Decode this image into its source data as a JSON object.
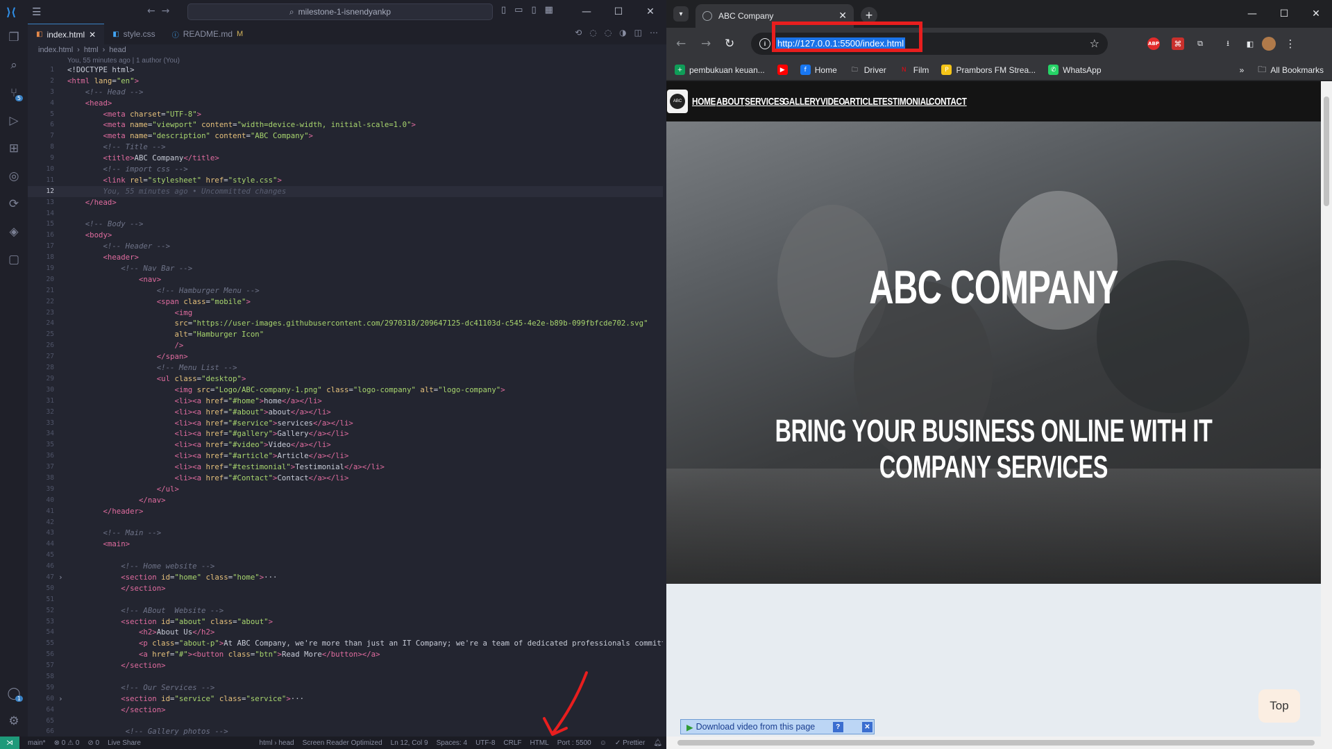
{
  "vscode": {
    "search": "milestone-1-isnendyankp",
    "tabs": [
      {
        "label": "index.html",
        "close": "✕"
      },
      {
        "label": "style.css"
      },
      {
        "label": "README.md",
        "mod": "M"
      }
    ],
    "breadcrumb": [
      "index.html",
      "html",
      "head"
    ],
    "blame": "You, 55 minutes ago | 1 author (You)",
    "status": {
      "branch": "main*",
      "problems": "⊗ 0 ⚠ 0",
      "ports": "⊘ 0",
      "liveshare": "Live Share",
      "scope": "html › head",
      "screenreader": "Screen Reader Optimized",
      "position": "Ln 12, Col 9",
      "spaces": "Spaces: 4",
      "encoding": "UTF-8",
      "eol": "CRLF",
      "language": "HTML",
      "port": "Port : 5500",
      "prettier": "✓ Prettier"
    },
    "code_lines": [
      {
        "n": "1",
        "h": "<span class=\"p\">&lt;!DOCTYPE html&gt;</span>"
      },
      {
        "n": "2",
        "h": "<span class=\"t\">&lt;html</span> <span class=\"a\">lang</span>=<span class=\"s\">\"en\"</span><span class=\"t\">&gt;</span>"
      },
      {
        "n": "3",
        "h": "    <span class=\"c\">&lt;!-- Head --&gt;</span>"
      },
      {
        "n": "4",
        "h": "    <span class=\"t\">&lt;head&gt;</span>"
      },
      {
        "n": "5",
        "h": "        <span class=\"t\">&lt;meta</span> <span class=\"a\">charset</span>=<span class=\"s\">\"UTF-8\"</span><span class=\"t\">&gt;</span>"
      },
      {
        "n": "6",
        "h": "        <span class=\"t\">&lt;meta</span> <span class=\"a\">name</span>=<span class=\"s\">\"viewport\"</span> <span class=\"a\">content</span>=<span class=\"s\">\"width=device-width, initial-scale=1.0\"</span><span class=\"t\">&gt;</span>"
      },
      {
        "n": "7",
        "h": "        <span class=\"t\">&lt;meta</span> <span class=\"a\">name</span>=<span class=\"s\">\"description\"</span> <span class=\"a\">content</span>=<span class=\"s\">\"ABC Company\"</span><span class=\"t\">&gt;</span>"
      },
      {
        "n": "8",
        "h": "        <span class=\"c\">&lt;!-- Title --&gt;</span>"
      },
      {
        "n": "9",
        "h": "        <span class=\"t\">&lt;title&gt;</span>ABC Company<span class=\"t\">&lt;/title&gt;</span>"
      },
      {
        "n": "10",
        "h": "        <span class=\"c\">&lt;!-- import css --&gt;</span>"
      },
      {
        "n": "11",
        "h": "        <span class=\"t\">&lt;link</span> <span class=\"a\">rel</span>=<span class=\"s\">\"stylesheet\"</span> <span class=\"a\">href</span>=<span class=\"s\">\"style.css\"</span><span class=\"t\">&gt;</span>"
      },
      {
        "n": "12",
        "h": "        <span class=\"g\">You, 55 minutes ago • Uncommitted changes</span>",
        "cur": true
      },
      {
        "n": "13",
        "h": "    <span class=\"t\">&lt;/head&gt;</span>"
      },
      {
        "n": "14",
        "h": ""
      },
      {
        "n": "15",
        "h": "    <span class=\"c\">&lt;!-- Body --&gt;</span>"
      },
      {
        "n": "16",
        "h": "    <span class=\"t\">&lt;body&gt;</span>"
      },
      {
        "n": "17",
        "h": "        <span class=\"c\">&lt;!-- Header --&gt;</span>"
      },
      {
        "n": "18",
        "h": "        <span class=\"t\">&lt;header&gt;</span>"
      },
      {
        "n": "19",
        "h": "            <span class=\"c\">&lt;!-- Nav Bar --&gt;</span>"
      },
      {
        "n": "20",
        "h": "                <span class=\"t\">&lt;nav&gt;</span>"
      },
      {
        "n": "21",
        "h": "                    <span class=\"c\">&lt;!-- Hamburger Menu --&gt;</span>"
      },
      {
        "n": "22",
        "h": "                    <span class=\"t\">&lt;span</span> <span class=\"a\">class</span>=<span class=\"s\">\"mobile\"</span><span class=\"t\">&gt;</span>"
      },
      {
        "n": "23",
        "h": "                        <span class=\"t\">&lt;img</span>"
      },
      {
        "n": "24",
        "h": "                        <span class=\"a\">src</span>=<span class=\"s\">\"https://user-images.githubusercontent.com/2970318/209647125-dc41103d-c545-4e2e-b89b-099fbfcde702.svg\"</span>"
      },
      {
        "n": "25",
        "h": "                        <span class=\"a\">alt</span>=<span class=\"s\">\"Hamburger Icon\"</span>"
      },
      {
        "n": "26",
        "h": "                        <span class=\"t\">/&gt;</span>"
      },
      {
        "n": "27",
        "h": "                    <span class=\"t\">&lt;/span&gt;</span>"
      },
      {
        "n": "28",
        "h": "                    <span class=\"c\">&lt;!-- Menu List --&gt;</span>"
      },
      {
        "n": "29",
        "h": "                    <span class=\"t\">&lt;ul</span> <span class=\"a\">class</span>=<span class=\"s\">\"desktop\"</span><span class=\"t\">&gt;</span>"
      },
      {
        "n": "30",
        "h": "                        <span class=\"t\">&lt;img</span> <span class=\"a\">src</span>=<span class=\"s\">\"Logo/ABC-company-1.png\"</span> <span class=\"a\">class</span>=<span class=\"s\">\"logo-company\"</span> <span class=\"a\">alt</span>=<span class=\"s\">\"logo-company\"</span><span class=\"t\">&gt;</span>"
      },
      {
        "n": "31",
        "h": "                        <span class=\"t\">&lt;li&gt;&lt;a</span> <span class=\"a\">href</span>=<span class=\"s\">\"#home\"</span><span class=\"t\">&gt;</span>home<span class=\"t\">&lt;/a&gt;&lt;/li&gt;</span>"
      },
      {
        "n": "32",
        "h": "                        <span class=\"t\">&lt;li&gt;&lt;a</span> <span class=\"a\">href</span>=<span class=\"s\">\"#about\"</span><span class=\"t\">&gt;</span>about<span class=\"t\">&lt;/a&gt;&lt;/li&gt;</span>"
      },
      {
        "n": "33",
        "h": "                        <span class=\"t\">&lt;li&gt;&lt;a</span> <span class=\"a\">href</span>=<span class=\"s\">\"#service\"</span><span class=\"t\">&gt;</span>services<span class=\"t\">&lt;/a&gt;&lt;/li&gt;</span>"
      },
      {
        "n": "34",
        "h": "                        <span class=\"t\">&lt;li&gt;&lt;a</span> <span class=\"a\">href</span>=<span class=\"s\">\"#gallery\"</span><span class=\"t\">&gt;</span>Gallery<span class=\"t\">&lt;/a&gt;&lt;/li&gt;</span>"
      },
      {
        "n": "35",
        "h": "                        <span class=\"t\">&lt;li&gt;&lt;a</span> <span class=\"a\">href</span>=<span class=\"s\">\"#video\"</span><span class=\"t\">&gt;</span>Video<span class=\"t\">&lt;/a&gt;&lt;/li&gt;</span>"
      },
      {
        "n": "36",
        "h": "                        <span class=\"t\">&lt;li&gt;&lt;a</span> <span class=\"a\">href</span>=<span class=\"s\">\"#article\"</span><span class=\"t\">&gt;</span>Article<span class=\"t\">&lt;/a&gt;&lt;/li&gt;</span>"
      },
      {
        "n": "37",
        "h": "                        <span class=\"t\">&lt;li&gt;&lt;a</span> <span class=\"a\">href</span>=<span class=\"s\">\"#testimonial\"</span><span class=\"t\">&gt;</span>Testimonial<span class=\"t\">&lt;/a&gt;&lt;/li&gt;</span>"
      },
      {
        "n": "38",
        "h": "                        <span class=\"t\">&lt;li&gt;&lt;a</span> <span class=\"a\">href</span>=<span class=\"s\">\"#Contact\"</span><span class=\"t\">&gt;</span>Contact<span class=\"t\">&lt;/a&gt;&lt;/li&gt;</span>"
      },
      {
        "n": "39",
        "h": "                    <span class=\"t\">&lt;/ul&gt;</span>"
      },
      {
        "n": "40",
        "h": "                <span class=\"t\">&lt;/nav&gt;</span>"
      },
      {
        "n": "41",
        "h": "        <span class=\"t\">&lt;/header&gt;</span>"
      },
      {
        "n": "42",
        "h": ""
      },
      {
        "n": "43",
        "h": "        <span class=\"c\">&lt;!-- Main --&gt;</span>"
      },
      {
        "n": "44",
        "h": "        <span class=\"t\">&lt;main&gt;</span>"
      },
      {
        "n": "45",
        "h": ""
      },
      {
        "n": "46",
        "h": "            <span class=\"c\">&lt;!-- Home website --&gt;</span>"
      },
      {
        "n": "47",
        "h": "            <span class=\"t\">&lt;section</span> <span class=\"a\">id</span>=<span class=\"s\">\"home\"</span> <span class=\"a\">class</span>=<span class=\"s\">\"home\"</span><span class=\"t\">&gt;</span>···",
        "fold": true
      },
      {
        "n": "50",
        "h": "            <span class=\"t\">&lt;/section&gt;</span>"
      },
      {
        "n": "51",
        "h": ""
      },
      {
        "n": "52",
        "h": "            <span class=\"c\">&lt;!-- ABout  Website --&gt;</span>"
      },
      {
        "n": "53",
        "h": "            <span class=\"t\">&lt;section</span> <span class=\"a\">id</span>=<span class=\"s\">\"about\"</span> <span class=\"a\">class</span>=<span class=\"s\">\"about\"</span><span class=\"t\">&gt;</span>"
      },
      {
        "n": "54",
        "h": "                <span class=\"t\">&lt;h2&gt;</span>About Us<span class=\"t\">&lt;/h2&gt;</span>"
      },
      {
        "n": "55",
        "h": "                <span class=\"t\">&lt;p</span> <span class=\"a\">class</span>=<span class=\"s\">\"about-p\"</span><span class=\"t\">&gt;</span>At ABC Company, we're more than just an IT Company; we're a team of dedicated professionals committe"
      },
      {
        "n": "56",
        "h": "                <span class=\"t\">&lt;a</span> <span class=\"a\">href</span>=<span class=\"s\">\"#\"</span><span class=\"t\">&gt;&lt;button</span> <span class=\"a\">class</span>=<span class=\"s\">\"btn\"</span><span class=\"t\">&gt;</span>Read More<span class=\"t\">&lt;/button&gt;&lt;/a&gt;</span>"
      },
      {
        "n": "57",
        "h": "            <span class=\"t\">&lt;/section&gt;</span>"
      },
      {
        "n": "58",
        "h": ""
      },
      {
        "n": "59",
        "h": "            <span class=\"c\">&lt;!-- Our Services --&gt;</span>"
      },
      {
        "n": "60",
        "h": "            <span class=\"t\">&lt;section</span> <span class=\"a\">id</span>=<span class=\"s\">\"service\"</span> <span class=\"a\">class</span>=<span class=\"s\">\"service\"</span><span class=\"t\">&gt;</span>···",
        "fold": true
      },
      {
        "n": "64",
        "h": "            <span class=\"t\">&lt;/section&gt;</span>"
      },
      {
        "n": "65",
        "h": ""
      },
      {
        "n": "66",
        "h": "             <span class=\"c\">&lt;!-- Gallery photos --&gt;</span>"
      }
    ]
  },
  "browser": {
    "tab_title": "ABC Company",
    "url": "http://127.0.0.1:5500/index.html",
    "bookmarks": [
      {
        "label": "pembukuan keuan...",
        "color": "#0f9d58",
        "glyph": "+"
      },
      {
        "label": "",
        "color": "#ff0000",
        "glyph": "▶"
      },
      {
        "label": "Home",
        "color": "#1877f2",
        "glyph": "f"
      },
      {
        "label": "Driver",
        "color": "transparent",
        "glyph": "🗀"
      },
      {
        "label": "Film",
        "color": "transparent",
        "glyph": "N"
      },
      {
        "label": "Prambors FM Strea...",
        "color": "#f5c518",
        "glyph": "P"
      },
      {
        "label": "WhatsApp",
        "color": "#25d366",
        "glyph": "✆"
      }
    ],
    "bookmarks_more": "»",
    "all_bookmarks": "All Bookmarks",
    "extensions": {
      "abp": "ABP"
    }
  },
  "site": {
    "logo_text": "ABC",
    "nav": [
      "HOME",
      "ABOUT",
      "SERVICES",
      "GALLERY",
      "VIDEO",
      "ARTICLE",
      "TESTIMONIAL",
      "CONTACT"
    ],
    "hero_title": "ABC COMPANY",
    "hero_subtitle": "BRING YOUR BUSINESS ONLINE WITH IT COMPANY SERVICES",
    "top_button": "Top",
    "download_bar": "Download video from this page",
    "download_q": "?",
    "download_x": "✕"
  },
  "colors": {
    "accent": "#1a73e8",
    "highlight_box": "#e81e1e",
    "vscode_bg": "#232530"
  }
}
